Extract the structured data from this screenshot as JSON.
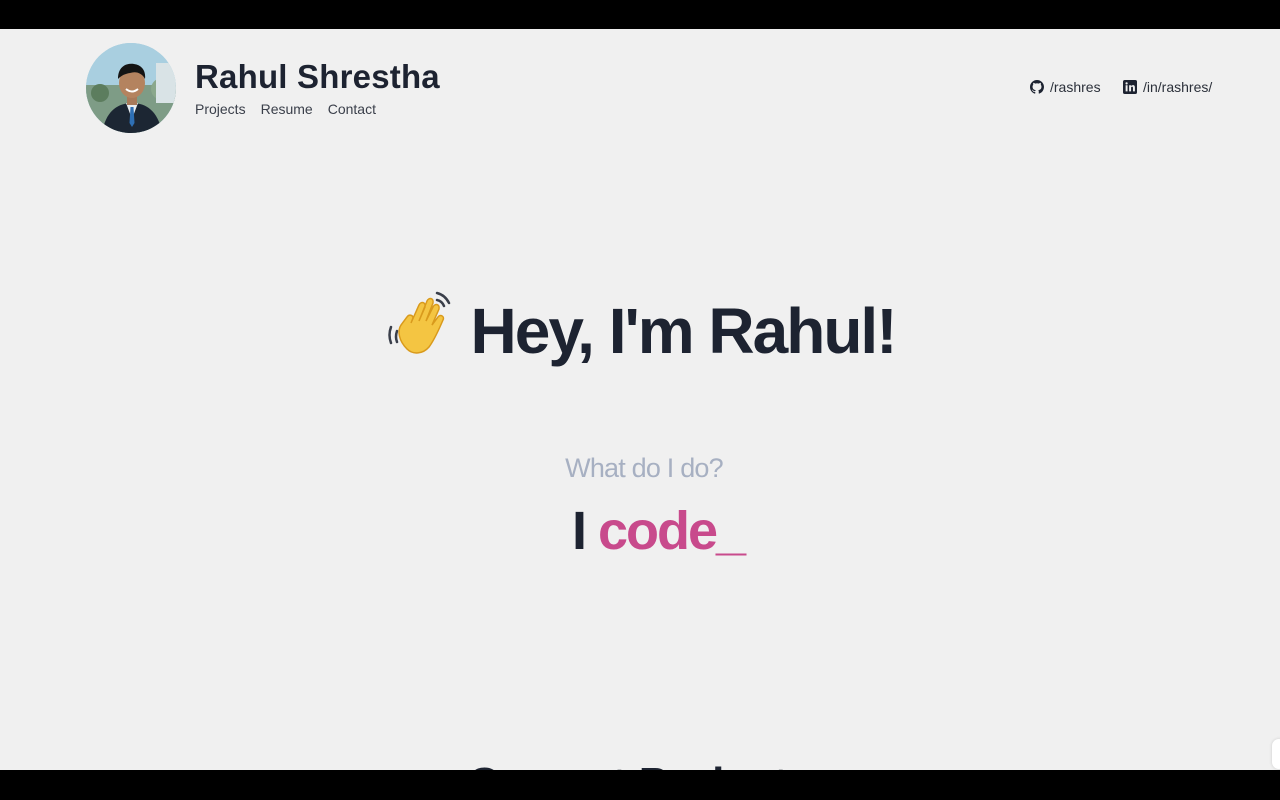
{
  "header": {
    "name": "Rahul Shrestha",
    "nav": [
      "Projects",
      "Resume",
      "Contact"
    ],
    "social": {
      "github_label": "/rashres",
      "linkedin_label": "/in/rashres/"
    }
  },
  "hero": {
    "greeting": "Hey, I'm Rahul!",
    "question": "What do I do?",
    "answer_prefix": "I",
    "answer_word": "code_"
  },
  "next_section": {
    "heading": "Current Projects"
  },
  "colors": {
    "background": "#f0f0f0",
    "heading": "#1d2331",
    "muted": "#a7b0c2",
    "accent": "#c84a8c"
  },
  "icons": {
    "github": "github-icon",
    "linkedin": "linkedin-icon",
    "greeting": "waving-hand-icon"
  }
}
